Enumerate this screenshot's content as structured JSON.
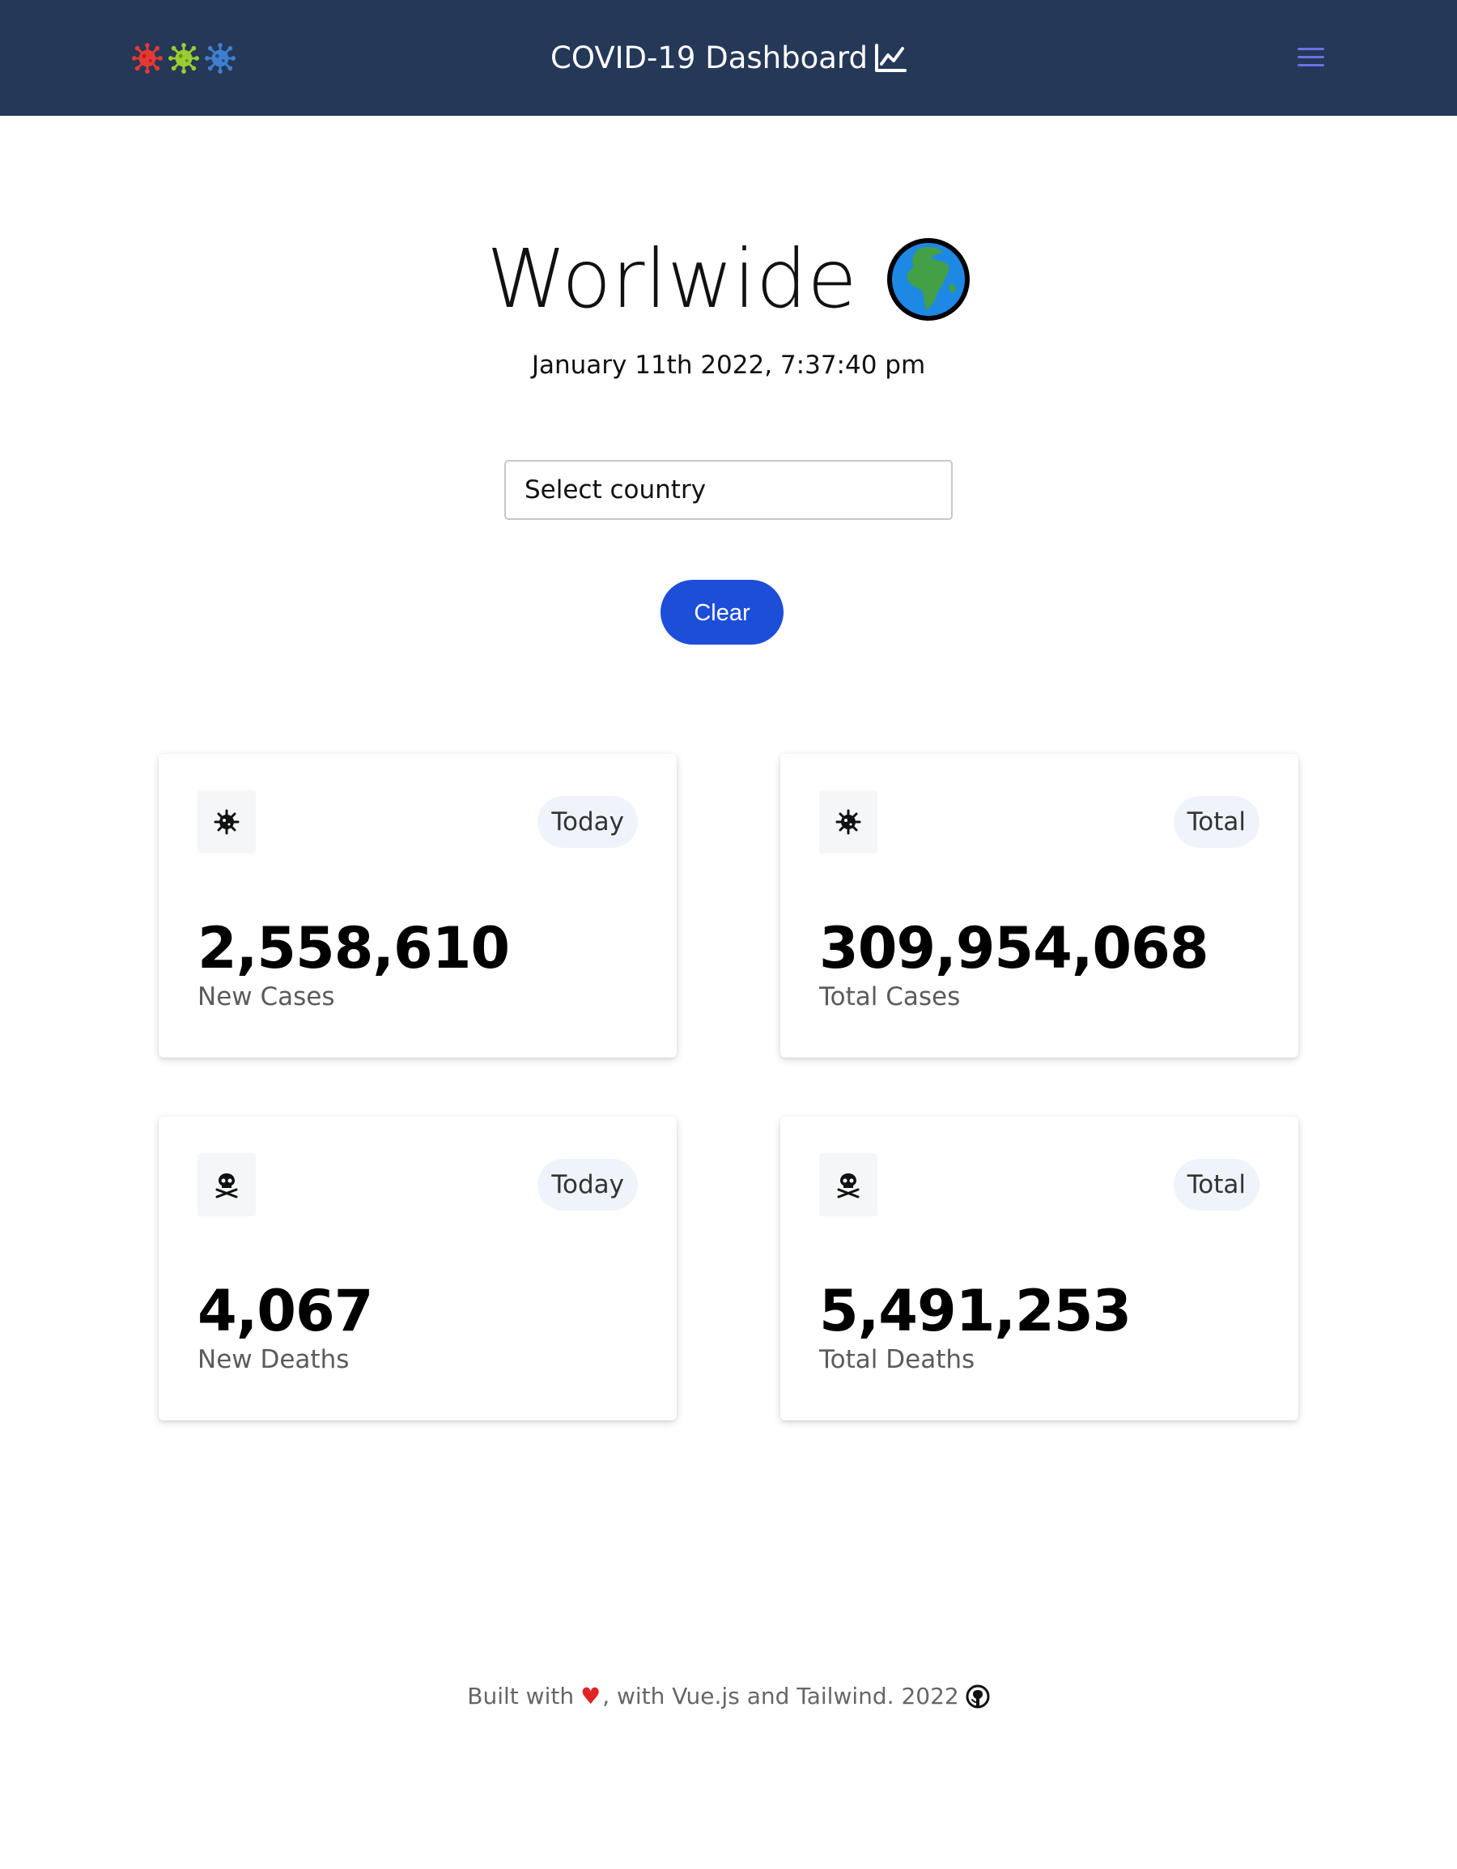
{
  "header": {
    "logo_icons": [
      "virus-icon-red",
      "virus-icon-green",
      "virus-icon-blue"
    ],
    "title": "COVID-19 Dashboard",
    "title_icon": "line-chart-icon",
    "menu_icon": "hamburger-menu-icon"
  },
  "hero": {
    "title": "Worlwide",
    "title_icon": "globe-icon",
    "datetime": "January 11th 2022, 7:37:40 pm"
  },
  "country_select": {
    "placeholder": "Select country"
  },
  "clear_button": {
    "label": "Clear"
  },
  "cards": [
    {
      "icon": "virus-icon",
      "badge": "Today",
      "value": "2,558,610",
      "label": "New Cases"
    },
    {
      "icon": "virus-icon",
      "badge": "Total",
      "value": "309,954,068",
      "label": "Total Cases"
    },
    {
      "icon": "skull-crossbones-icon",
      "badge": "Today",
      "value": "4,067",
      "label": "New Deaths"
    },
    {
      "icon": "skull-crossbones-icon",
      "badge": "Total",
      "value": "5,491,253",
      "label": "Total Deaths"
    }
  ],
  "footer": {
    "text_before": "Built with",
    "heart": "♥",
    "text_after": ", with Vue.js and Tailwind. 2022",
    "icon": "github-icon"
  },
  "colors": {
    "navbar": "#253858",
    "accent_button": "#1d4ed8",
    "menu_icon": "#6b72e6",
    "heart": "#e02424",
    "logo_red": "#e53935",
    "logo_green": "#9acd32",
    "logo_blue": "#3f7fcf"
  }
}
